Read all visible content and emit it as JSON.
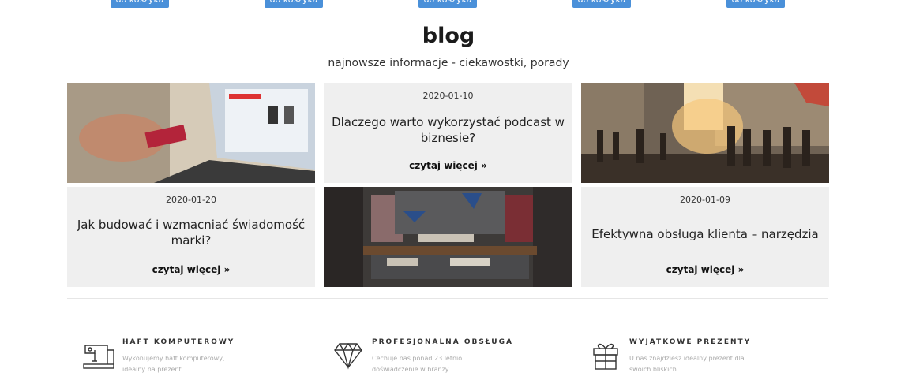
{
  "top_buttons": {
    "label": "do koszyka"
  },
  "blog": {
    "title": "blog",
    "subtitle": "najnowsze informacje - ciekawostki, porady",
    "read_more": "czytaj więcej »",
    "posts": [
      {
        "date": "2020-01-10",
        "title": "Dlaczego warto wykorzystać podcast w biznesie?"
      },
      {
        "date": "2020-01-20",
        "title": "Jak budować i wzmacniać świadomość marki?"
      },
      {
        "date": "2020-01-09",
        "title": "Efektywna obsługa klienta – narzędzia"
      }
    ]
  },
  "features": [
    {
      "icon": "sewing-machine-icon",
      "title": "HAFT KOMPUTEROWY",
      "desc_line1": "Wykonujemy haft komputerowy,",
      "desc_line2": "idealny na prezent."
    },
    {
      "icon": "diamond-icon",
      "title": "PROFESJONALNA OBSŁUGA",
      "desc_line1": "Cechuje nas ponad 23 letnio",
      "desc_line2": "doświadczenie w branży."
    },
    {
      "icon": "gift-icon",
      "title": "WYJĄTKOWE PREZENTY",
      "desc_line1": "U nas znajdziesz idealny prezent dla",
      "desc_line2": "swoich bliskich."
    }
  ],
  "colors": {
    "accent": "#4a90d9",
    "card_bg": "#efefef"
  }
}
